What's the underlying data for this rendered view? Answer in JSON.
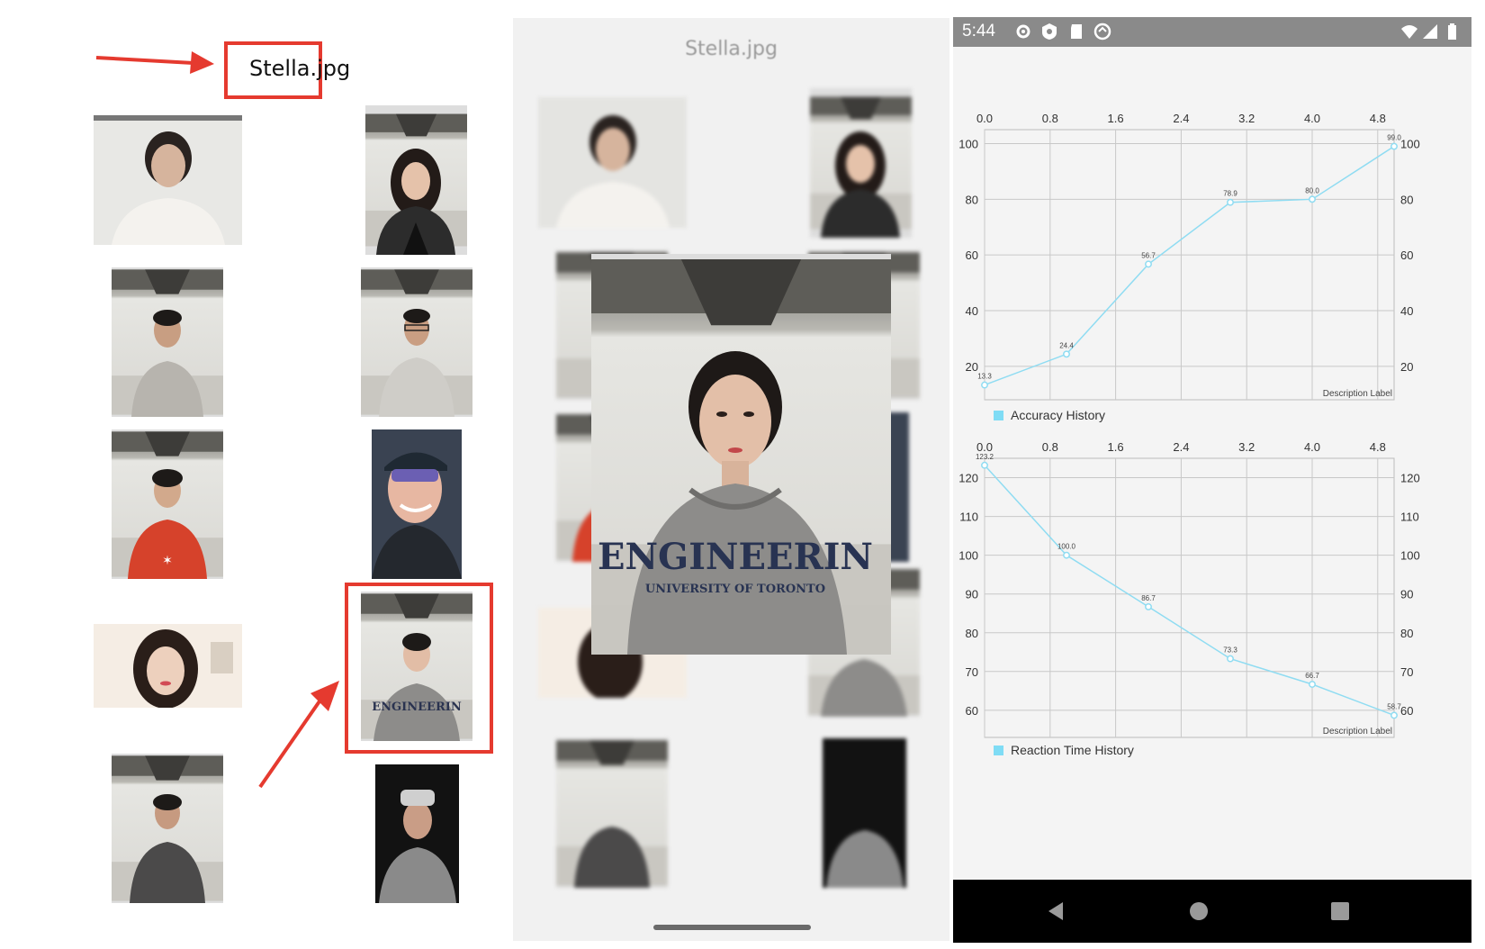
{
  "left": {
    "filename": "Stella.jpg"
  },
  "middle": {
    "title": "Stella.jpg",
    "hoodie_text": "ENGINEERIN",
    "hoodie_subtext": "UNIVERSITY OF TORONTO"
  },
  "phone": {
    "status_time": "5:44",
    "status_icons": [
      "gear-icon",
      "shield-icon",
      "sd-card-icon",
      "sync-icon"
    ],
    "status_right_icons": [
      "wifi-icon",
      "signal-icon",
      "battery-icon"
    ],
    "nav_buttons": [
      "back-icon",
      "home-icon",
      "recents-icon"
    ]
  },
  "chart_data": [
    {
      "type": "line",
      "title": "",
      "legend": "Accuracy History",
      "description": "Description Label",
      "x_ticks": [
        "0.0",
        "0.8",
        "1.6",
        "2.4",
        "3.2",
        "4.0",
        "4.8"
      ],
      "xlim": [
        0,
        5
      ],
      "ylim": [
        8,
        105
      ],
      "y_ticks": [
        20,
        40,
        60,
        80,
        100
      ],
      "x": [
        0,
        1,
        2,
        3,
        4,
        5
      ],
      "values": [
        13.3,
        24.4,
        56.7,
        78.9,
        80.0,
        99.0
      ],
      "value_labels": [
        "13.3",
        "24.4",
        "56.7",
        "78.9",
        "80.0",
        "99.0"
      ],
      "color": "#8fdcf2",
      "legend_position": "bottom-left",
      "grid": true
    },
    {
      "type": "line",
      "title": "",
      "legend": "Reaction Time History",
      "description": "Description Label",
      "x_ticks": [
        "0.0",
        "0.8",
        "1.6",
        "2.4",
        "3.2",
        "4.0",
        "4.8"
      ],
      "xlim": [
        0,
        5
      ],
      "ylim": [
        53,
        125
      ],
      "y_ticks": [
        60,
        70,
        80,
        90,
        100,
        110,
        120
      ],
      "x": [
        0,
        1,
        2,
        3,
        4,
        5
      ],
      "values": [
        123.2,
        100.0,
        86.7,
        73.3,
        66.7,
        58.7
      ],
      "value_labels": [
        "123.2",
        "100.0",
        "86.7",
        "73.3",
        "66.7",
        "58.7"
      ],
      "color": "#8fdcf2",
      "legend_position": "bottom-left",
      "grid": true
    }
  ]
}
